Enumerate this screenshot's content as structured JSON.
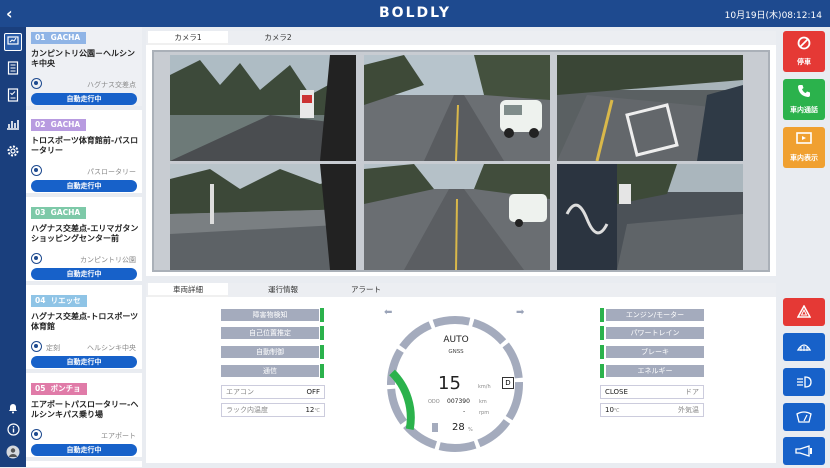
{
  "header": {
    "back": "‹",
    "logo": "BOLDLY",
    "datetime": "10月19日(木)08:12:14"
  },
  "rail": {
    "icons": [
      "monitor-icon",
      "document-icon",
      "checklist-icon",
      "chart-icon",
      "gear-icon",
      "bell-icon",
      "info-icon",
      "user-icon"
    ]
  },
  "vehicles": [
    {
      "no": "01",
      "name": "GACHA",
      "tag_color": "#8fb4e6",
      "title": "カンピントリ公園－ヘルシンキ中央",
      "stop": "ハグナス交差点",
      "status": "自動走行中"
    },
    {
      "no": "02",
      "name": "GACHA",
      "tag_color": "#b89be0",
      "title": "トロスポーツ体育館前-パスロータリー",
      "stop": "パスロータリー",
      "status": "自動走行中"
    },
    {
      "no": "03",
      "name": "GACHA",
      "tag_color": "#7dc9a8",
      "title": "ハグナス交差点-エリマガタンショッピングセンター前",
      "stop": "カンピントリ公園",
      "status": "自動走行中"
    },
    {
      "no": "04",
      "name": "リエッセ",
      "tag_color": "#8fc4e6",
      "title": "ハグナス交差点-トロスポーツ体育館",
      "stop": "ヘルシンキ中央",
      "stop_prefix": "定刻",
      "status": "自動走行中"
    },
    {
      "no": "05",
      "name": "ポンチョ",
      "tag_color": "#e07ba8",
      "title": "エアポートパスロータリー-ヘルシンキパス乗り場",
      "stop": "エアポート",
      "status": "自動走行中"
    }
  ],
  "camera": {
    "tabs": [
      "カメラ1",
      "カメラ2"
    ]
  },
  "detail": {
    "tabs": [
      "車両詳細",
      "運行情報",
      "アラート"
    ],
    "left_status": [
      "障害物検知",
      "自己位置推定",
      "自動制御",
      "通信"
    ],
    "aircon": {
      "label": "エアコン",
      "value": "OFF"
    },
    "rack_temp": {
      "label": "ラック内温度",
      "value": "12",
      "unit": "℃"
    },
    "mode": "AUTO",
    "positioning": "GNSS",
    "speed": "15",
    "speed_unit": "km/h",
    "gear": "D",
    "odo_label": "ODO",
    "odo": "007390",
    "odo_unit": "km",
    "rpm_value": "-",
    "rpm_unit": "rpm",
    "battery": "28",
    "battery_unit": "%",
    "battery_level": 0.28,
    "right_status": [
      "エンジン/モーター",
      "パワートレイン",
      "ブレーキ",
      "エネルギー"
    ],
    "door": {
      "label": "ドア",
      "value": "CLOSE"
    },
    "outside_temp": {
      "label": "外気温",
      "value": "10",
      "unit": "℃"
    }
  },
  "actions": {
    "stop": {
      "label": "停車",
      "icon": "prohibit-icon",
      "color": "#e53935"
    },
    "call": {
      "label": "車内通話",
      "icon": "phone-icon",
      "color": "#2bb24c"
    },
    "display": {
      "label": "車内表示",
      "icon": "display-icon",
      "color": "#f0a030"
    },
    "small": [
      "hazard-icon",
      "defroster-icon",
      "headlight-icon",
      "wiper-icon",
      "horn-icon"
    ]
  }
}
